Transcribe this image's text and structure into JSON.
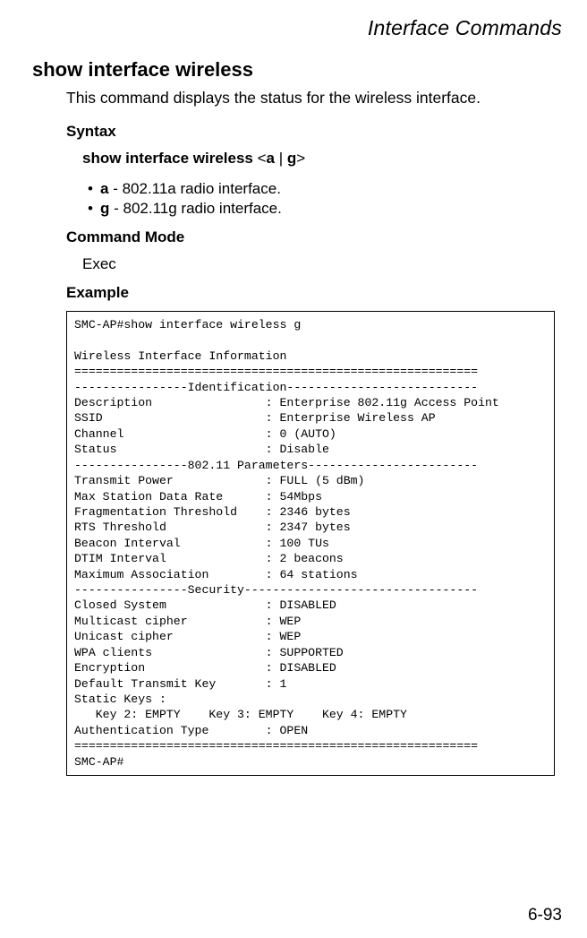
{
  "header": {
    "chapter": "Interface Commands"
  },
  "title": "show interface wireless",
  "intro": "This command displays the status for the wireless interface.",
  "syntax": {
    "heading": "Syntax",
    "command": "show interface wireless",
    "open_angle": "<",
    "a": "a",
    "pipe": " | ",
    "g": "g",
    "close_angle": ">",
    "bullet_a_letter": "a",
    "bullet_a_rest": " - 802.11a radio interface.",
    "bullet_g_letter": "g",
    "bullet_g_rest": " - 802.11g radio interface."
  },
  "command_mode": {
    "heading": "Command Mode",
    "value": "Exec"
  },
  "example": {
    "heading": "Example",
    "terminal": "SMC-AP#show interface wireless g\n\nWireless Interface Information\n=========================================================\n----------------Identification---------------------------\nDescription                : Enterprise 802.11g Access Point\nSSID                       : Enterprise Wireless AP\nChannel                    : 0 (AUTO)\nStatus                     : Disable\n----------------802.11 Parameters------------------------\nTransmit Power             : FULL (5 dBm)\nMax Station Data Rate      : 54Mbps\nFragmentation Threshold    : 2346 bytes\nRTS Threshold              : 2347 bytes\nBeacon Interval            : 100 TUs\nDTIM Interval              : 2 beacons\nMaximum Association        : 64 stations\n----------------Security---------------------------------\nClosed System              : DISABLED\nMulticast cipher           : WEP\nUnicast cipher             : WEP\nWPA clients                : SUPPORTED\nEncryption                 : DISABLED\nDefault Transmit Key       : 1\nStatic Keys : \n   Key 2: EMPTY    Key 3: EMPTY    Key 4: EMPTY  \nAuthentication Type        : OPEN\n=========================================================\nSMC-AP#"
  },
  "page_number": "6-93"
}
